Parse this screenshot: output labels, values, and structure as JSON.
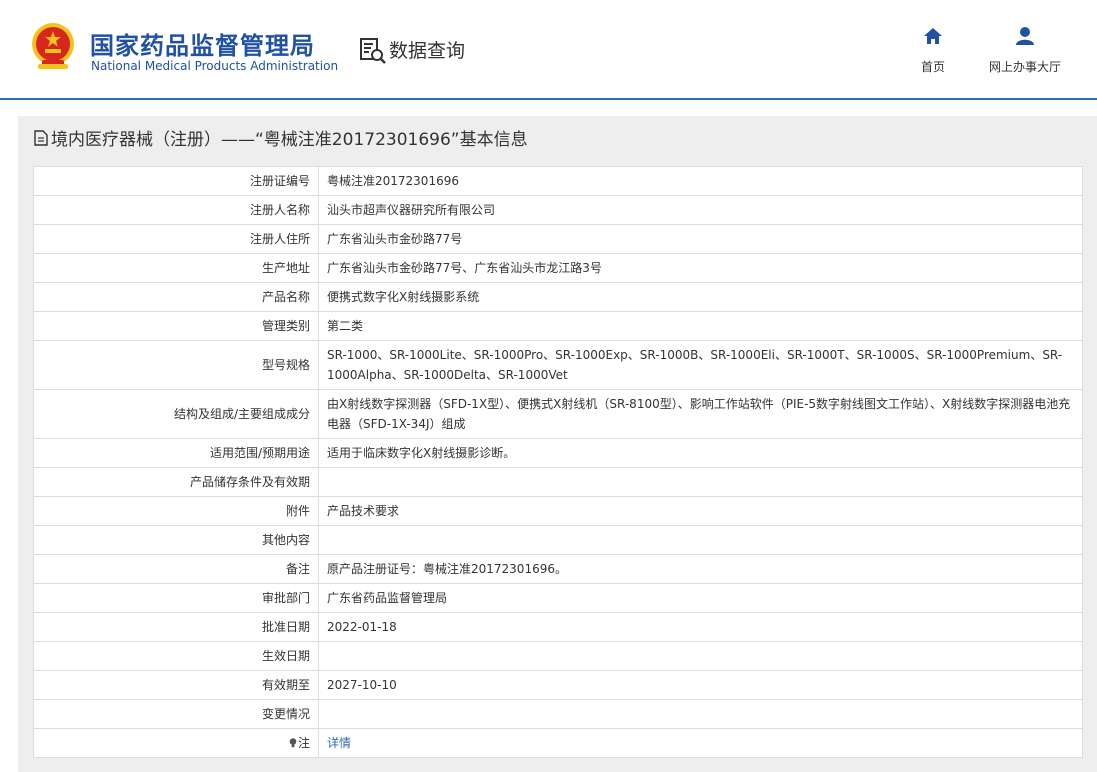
{
  "header": {
    "brand_cn": "国家药品监督管理局",
    "brand_en": "National Medical Products Administration",
    "query_title": "数据查询",
    "nav": {
      "home": "首页",
      "hall": "网上办事大厅"
    }
  },
  "panel": {
    "title": "境内医疗器械（注册）——“粤械注准20172301696”基本信息"
  },
  "rows": [
    {
      "label": "注册证编号",
      "value": "粤械注准20172301696"
    },
    {
      "label": "注册人名称",
      "value": "汕头市超声仪器研究所有限公司"
    },
    {
      "label": "注册人住所",
      "value": "广东省汕头市金砂路77号"
    },
    {
      "label": "生产地址",
      "value": "广东省汕头市金砂路77号、广东省汕头市龙江路3号"
    },
    {
      "label": "产品名称",
      "value": "便携式数字化X射线摄影系统"
    },
    {
      "label": "管理类别",
      "value": "第二类"
    },
    {
      "label": "型号规格",
      "value": "SR-1000、SR-1000Lite、SR-1000Pro、SR-1000Exp、SR-1000B、SR-1000Eli、SR-1000T、SR-1000S、SR-1000Premium、SR-1000Alpha、SR-1000Delta、SR-1000Vet"
    },
    {
      "label": "结构及组成/主要组成成分",
      "value": "由X射线数字探测器（SFD-1X型）、便携式X射线机（SR-8100型）、影响工作站软件（PIE-5数字射线图文工作站）、X射线数字探测器电池充电器（SFD-1X-34J）组成"
    },
    {
      "label": "适用范围/预期用途",
      "value": "适用于临床数字化X射线摄影诊断。"
    },
    {
      "label": "产品储存条件及有效期",
      "value": ""
    },
    {
      "label": "附件",
      "value": "产品技术要求"
    },
    {
      "label": "其他内容",
      "value": ""
    },
    {
      "label": "备注",
      "value": "原产品注册证号：粤械注准20172301696。"
    },
    {
      "label": "审批部门",
      "value": "广东省药品监督管理局"
    },
    {
      "label": "批准日期",
      "value": "2022-01-18"
    },
    {
      "label": "生效日期",
      "value": ""
    },
    {
      "label": "有效期至",
      "value": "2027-10-10"
    },
    {
      "label": "变更情况",
      "value": ""
    }
  ],
  "note_row": {
    "label": "注",
    "link": "详情"
  },
  "colors": {
    "brand_blue": "#2051a5",
    "accent_blue": "#2d6eb6",
    "emblem_red": "#d7261e",
    "emblem_gold": "#f3c21b"
  }
}
